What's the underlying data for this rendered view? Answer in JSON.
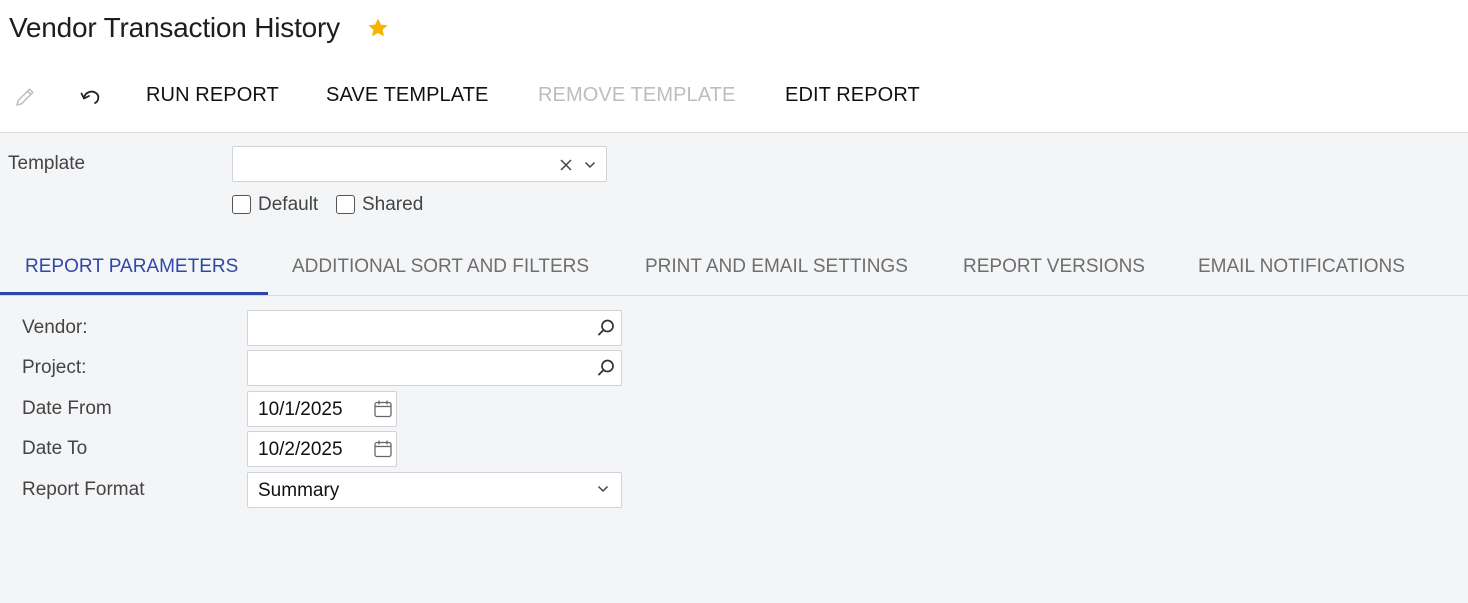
{
  "header": {
    "title": "Vendor Transaction History"
  },
  "toolbar": {
    "run_report": "RUN REPORT",
    "save_template": "SAVE TEMPLATE",
    "remove_template": "REMOVE TEMPLATE",
    "edit_report": "EDIT REPORT"
  },
  "template": {
    "label": "Template",
    "value": "",
    "default_label": "Default",
    "default_checked": false,
    "shared_label": "Shared",
    "shared_checked": false
  },
  "tabs": [
    {
      "label": "REPORT PARAMETERS",
      "active": true
    },
    {
      "label": "ADDITIONAL SORT AND FILTERS",
      "active": false
    },
    {
      "label": "PRINT AND EMAIL SETTINGS",
      "active": false
    },
    {
      "label": "REPORT VERSIONS",
      "active": false
    },
    {
      "label": "EMAIL NOTIFICATIONS",
      "active": false
    }
  ],
  "params": {
    "vendor": {
      "label": "Vendor:",
      "value": ""
    },
    "project": {
      "label": "Project:",
      "value": ""
    },
    "date_from": {
      "label": "Date From",
      "value": "10/1/2025"
    },
    "date_to": {
      "label": "Date To",
      "value": "10/2/2025"
    },
    "report_format": {
      "label": "Report Format",
      "value": "Summary"
    }
  },
  "colors": {
    "accent": "#2d48a8",
    "star": "#f5b400",
    "disabled": "#bdbdbd"
  },
  "icons": {
    "edit": "pencil-icon",
    "undo": "undo-icon",
    "favorite": "star-icon",
    "clear": "close-icon",
    "dropdown": "chevron-down-icon",
    "lookup": "search-icon",
    "date": "calendar-icon"
  }
}
